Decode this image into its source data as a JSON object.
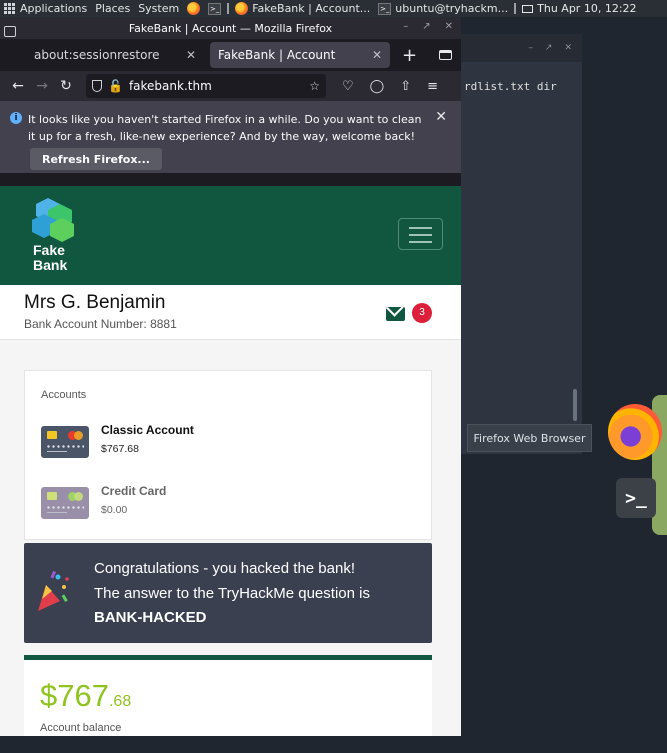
{
  "top_panel": {
    "applications": "Applications",
    "places": "Places",
    "system": "System",
    "task_firefox": "FakeBank | Account...",
    "task_terminal": "ubuntu@tryhackm...",
    "clock": "Thu Apr 10, 12:22"
  },
  "terminal": {
    "text": "rdlist.txt dir"
  },
  "tooltip": "Firefox Web Browser",
  "dock": {
    "terminal_glyph": ">_"
  },
  "firefox": {
    "window_title": "FakeBank | Account — Mozilla Firefox",
    "tabs": [
      {
        "label": "about:sessionrestore"
      },
      {
        "label": "FakeBank | Account"
      }
    ],
    "url": "fakebank.thm",
    "notice": {
      "text": "It looks like you haven't started Firefox in a while. Do you want to clean it up for a fresh, like-new experience? And by the way, welcome back!",
      "button": "Refresh Firefox..."
    }
  },
  "bank": {
    "logo_line1": "Fake",
    "logo_line2": "Bank",
    "user_name": "Mrs G. Benjamin",
    "account_number": "Bank Account Number: 8881",
    "mail_badge": "3",
    "accounts_label": "Accounts",
    "accounts": [
      {
        "name": "Classic Account",
        "balance": "$767.68",
        "card_color": "#4a5568"
      },
      {
        "name": "Credit Card",
        "balance": "$0.00",
        "card_color": "#9a8fa8"
      }
    ],
    "congrats": {
      "line1": "Congratulations - you hacked the bank!",
      "line2": "The answer to the TryHackMe question is",
      "answer": "BANK-HACKED"
    },
    "balance_main": "$767",
    "balance_cents": ".68",
    "balance_label": "Account balance"
  },
  "colors": {
    "brand_green": "#115740",
    "balance_green": "#8fc31f",
    "badge_red": "#dc1f3a"
  }
}
